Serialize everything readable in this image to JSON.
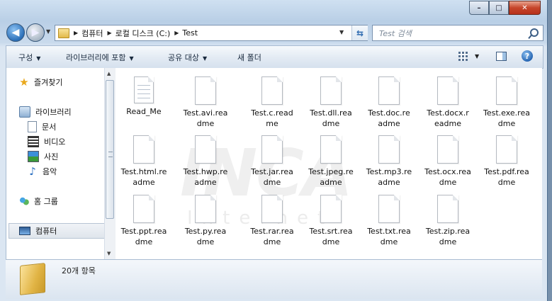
{
  "window": {
    "caption_buttons": {
      "minimize": "–",
      "maximize": "□",
      "close": "✕"
    }
  },
  "address": {
    "crumbs": [
      "컴퓨터",
      "로컬 디스크 (C:)",
      "Test"
    ],
    "search_placeholder": "Test 검색"
  },
  "toolbar": {
    "organize": "구성",
    "include_library": "라이브러리에 포함",
    "share": "공유 대상",
    "new_folder": "새 폴더",
    "help": "?"
  },
  "nav": {
    "favorites": "즐겨찾기",
    "libraries": "라이브러리",
    "documents": "문서",
    "videos": "비디오",
    "pictures": "사진",
    "music": "음악",
    "homegroup": "홈 그룹",
    "computer": "컴퓨터"
  },
  "watermark": {
    "main": "INCA",
    "sub": "Internet"
  },
  "files": [
    {
      "line1": "Read_Me",
      "line2": ""
    },
    {
      "line1": "Test.avi.rea",
      "line2": "dme"
    },
    {
      "line1": "Test.c.read",
      "line2": "me"
    },
    {
      "line1": "Test.dll.rea",
      "line2": "dme"
    },
    {
      "line1": "Test.doc.re",
      "line2": "adme"
    },
    {
      "line1": "Test.docx.r",
      "line2": "eadme"
    },
    {
      "line1": "Test.exe.rea",
      "line2": "dme"
    },
    {
      "line1": "Test.html.re",
      "line2": "adme"
    },
    {
      "line1": "Test.hwp.re",
      "line2": "adme"
    },
    {
      "line1": "Test.jar.rea",
      "line2": "dme"
    },
    {
      "line1": "Test.jpeg.re",
      "line2": "adme"
    },
    {
      "line1": "Test.mp3.re",
      "line2": "adme"
    },
    {
      "line1": "Test.ocx.rea",
      "line2": "dme"
    },
    {
      "line1": "Test.pdf.rea",
      "line2": "dme"
    },
    {
      "line1": "Test.ppt.rea",
      "line2": "dme"
    },
    {
      "line1": "Test.py.rea",
      "line2": "dme"
    },
    {
      "line1": "Test.rar.rea",
      "line2": "dme"
    },
    {
      "line1": "Test.srt.rea",
      "line2": "dme"
    },
    {
      "line1": "Test.txt.rea",
      "line2": "dme"
    },
    {
      "line1": "Test.zip.rea",
      "line2": "dme"
    }
  ],
  "details": {
    "item_count": "20개 항목"
  }
}
